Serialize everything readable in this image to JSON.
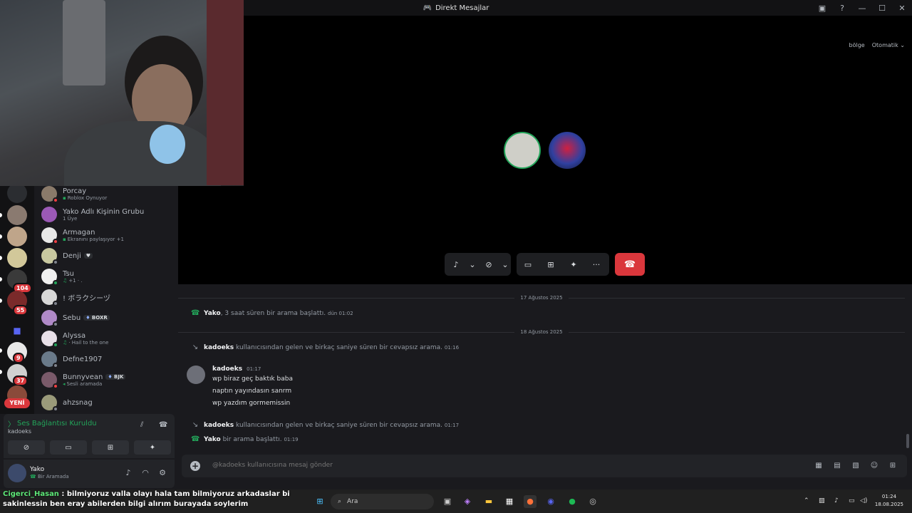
{
  "titlebar": {
    "title": "Direkt Mesajlar"
  },
  "call": {
    "region_label": "bölge",
    "region_value": "Otomatik"
  },
  "rail": {
    "badges": [
      "104",
      "55",
      "9",
      "37"
    ],
    "new_label": "YENİ"
  },
  "dms": [
    {
      "name": "Porcay",
      "sub": "Roblox Oynuyor"
    },
    {
      "name": "Yako Adlı Kişinin Grubu",
      "sub": "1 Üye"
    },
    {
      "name": "Armagan",
      "sub": "Ekranını paylaşıyor +1"
    },
    {
      "name": "Denji",
      "sub": ""
    },
    {
      "name": "Tsu",
      "sub": "+1 · ."
    },
    {
      "name": "! ボラクシーヅ",
      "sub": ""
    },
    {
      "name": "Sebu",
      "tag": "BOXR",
      "sub": ""
    },
    {
      "name": "Alyssa",
      "sub": "· Hail to the one"
    },
    {
      "name": "Defne1907",
      "sub": ""
    },
    {
      "name": "Bunnyvean",
      "tag": "BJK",
      "sub": "Sesli aramada"
    },
    {
      "name": "ahzsnag",
      "sub": ""
    }
  ],
  "voice": {
    "status": "Ses Bağlantısı Kuruldu",
    "channel": "kadoeks"
  },
  "user": {
    "name": "Yako",
    "status": "Bir Aramada"
  },
  "chat": {
    "date1": "17 Ağustos 2025",
    "date2": "18 Ağustos 2025",
    "sys1": {
      "user": "Yako",
      "text": ", 3 saat süren bir arama başlattı.",
      "time": "dün 01:02"
    },
    "sys2": {
      "user": "kadoeks",
      "text": "kullanıcısından gelen ve birkaç saniye süren bir cevapsız arama.",
      "time": "01:16"
    },
    "msg": {
      "author": "kadoeks",
      "time": "01:17",
      "lines": [
        "wp biraz geç baktık baba",
        "naptın yayındasın sanrm",
        "wp yazdım gormemissin"
      ]
    },
    "sys3": {
      "user": "kadoeks",
      "text": "kullanıcısından gelen ve birkaç saniye süren bir cevapsız arama.",
      "time": "01:17"
    },
    "sys4": {
      "user": "Yako",
      "text": "bir arama başlattı.",
      "time": "01:19"
    },
    "input_placeholder": "@kadoeks kullanıcısına mesaj gönder"
  },
  "taskbar": {
    "overlay_user": "Cigerci_Hasan",
    "overlay_text": " : bilmiyoruz valla olayı hala tam bilmiyoruz arkadaslar bi sakinlessin ben eray abilerden bilgi alırım burayada soylerim",
    "search_label": "Ara",
    "time": "01:24",
    "date": "18.08.2025"
  }
}
